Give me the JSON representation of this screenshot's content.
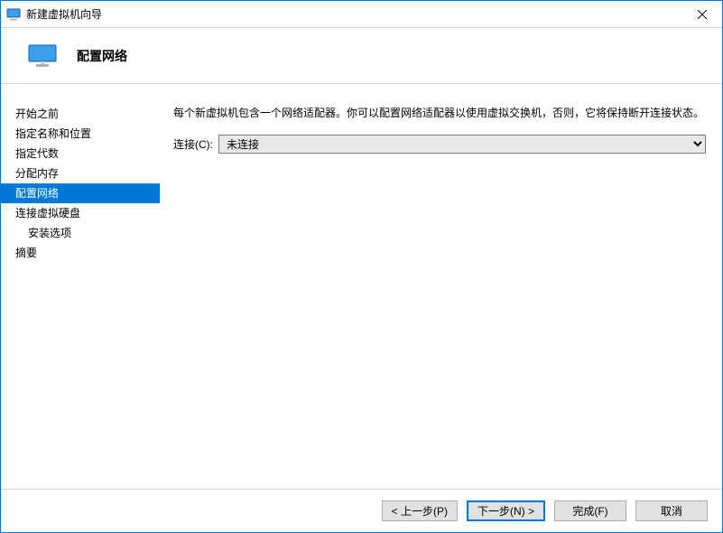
{
  "window": {
    "title": "新建虚拟机向导"
  },
  "header": {
    "heading": "配置网络"
  },
  "sidebar": {
    "items": [
      {
        "label": "开始之前",
        "active": false,
        "indent": false
      },
      {
        "label": "指定名称和位置",
        "active": false,
        "indent": false
      },
      {
        "label": "指定代数",
        "active": false,
        "indent": false
      },
      {
        "label": "分配内存",
        "active": false,
        "indent": false
      },
      {
        "label": "配置网络",
        "active": true,
        "indent": false
      },
      {
        "label": "连接虚拟硬盘",
        "active": false,
        "indent": false
      },
      {
        "label": "安装选项",
        "active": false,
        "indent": true
      },
      {
        "label": "摘要",
        "active": false,
        "indent": false
      }
    ]
  },
  "main": {
    "description": "每个新虚拟机包含一个网络适配器。你可以配置网络适配器以使用虚拟交换机，否则，它将保持断开连接状态。",
    "connection_label": "连接(C):",
    "connection_selected": "未连接"
  },
  "footer": {
    "prev": "< 上一步(P)",
    "next": "下一步(N) >",
    "finish": "完成(F)",
    "cancel": "取消"
  }
}
